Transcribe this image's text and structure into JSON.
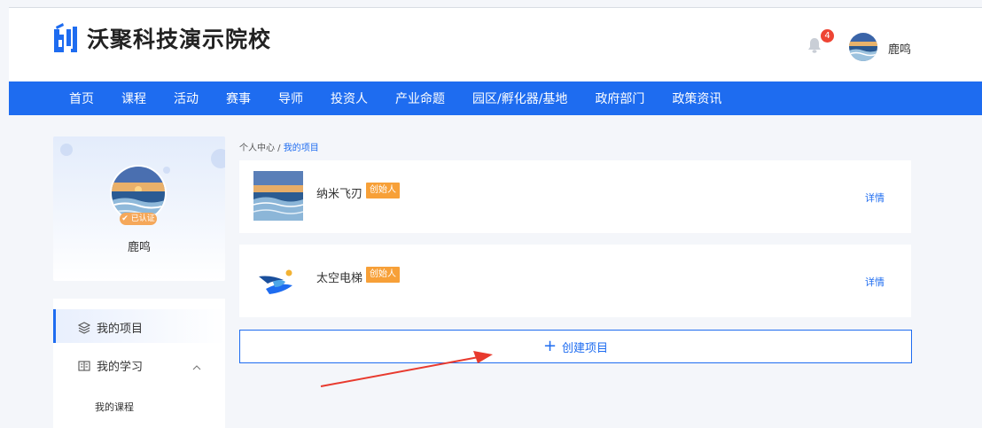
{
  "header": {
    "site_name": "沃聚科技演示院校",
    "notification_count": "4",
    "username": "鹿鸣"
  },
  "nav": {
    "items": [
      "首页",
      "课程",
      "活动",
      "赛事",
      "导师",
      "投资人",
      "产业命题",
      "园区/孵化器/基地",
      "政府部门",
      "政策资讯"
    ]
  },
  "profile": {
    "badge": "已认证",
    "name": "鹿鸣"
  },
  "sidebar": {
    "items": [
      {
        "label": "我的项目",
        "icon": "layers-icon",
        "active": true
      },
      {
        "label": "我的学习",
        "icon": "book-icon",
        "expanded": true
      }
    ],
    "sub_items": [
      "我的课程"
    ]
  },
  "breadcrumb": {
    "root": "个人中心",
    "separator": " / ",
    "current": "我的项目"
  },
  "projects": [
    {
      "name": "纳米飞刃",
      "role": "创始人",
      "action": "详情",
      "thumb": "ocean-photo"
    },
    {
      "name": "太空电梯",
      "role": "创始人",
      "action": "详情",
      "thumb": "blue-swirl-logo"
    }
  ],
  "create_button": {
    "label": "创建项目"
  },
  "colors": {
    "primary": "#1e6cf0",
    "tag": "#f7a038",
    "badge": "#ee4433",
    "annotation_arrow": "#e83a2e"
  }
}
